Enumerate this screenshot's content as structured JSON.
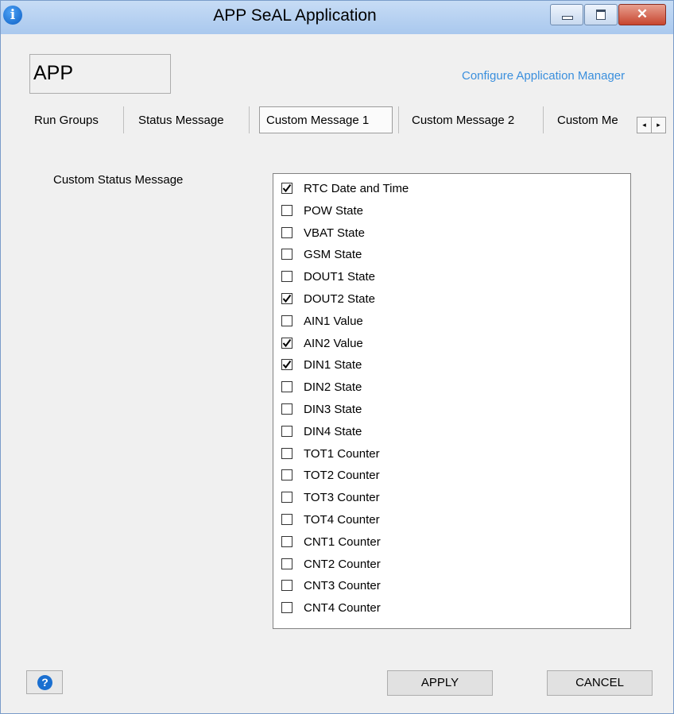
{
  "window": {
    "title": "APP SeAL Application",
    "icon": "info-icon",
    "icon_glyph": "i",
    "close_glyph": "✕",
    "accent_color": "#3a8fdd"
  },
  "header": {
    "app_name": "APP",
    "configure_link": "Configure Application Manager"
  },
  "tabs": [
    {
      "label": "Run Groups",
      "active": false
    },
    {
      "label": "Status Message",
      "active": false
    },
    {
      "label": "Custom Message 1",
      "active": true
    },
    {
      "label": "Custom Message 2",
      "active": false
    },
    {
      "label": "Custom Me",
      "active": false
    }
  ],
  "tab_scroll": {
    "left": "◂",
    "right": "▸"
  },
  "main": {
    "section_label": "Custom Status Message",
    "items": [
      {
        "label": "RTC Date and Time",
        "checked": true
      },
      {
        "label": "POW State",
        "checked": false
      },
      {
        "label": "VBAT State",
        "checked": false
      },
      {
        "label": "GSM State",
        "checked": false
      },
      {
        "label": "DOUT1 State",
        "checked": false
      },
      {
        "label": "DOUT2 State",
        "checked": true
      },
      {
        "label": "AIN1 Value",
        "checked": false
      },
      {
        "label": "AIN2 Value",
        "checked": true
      },
      {
        "label": "DIN1 State",
        "checked": true
      },
      {
        "label": "DIN2 State",
        "checked": false
      },
      {
        "label": "DIN3 State",
        "checked": false
      },
      {
        "label": "DIN4 State",
        "checked": false
      },
      {
        "label": "TOT1 Counter",
        "checked": false
      },
      {
        "label": "TOT2 Counter",
        "checked": false
      },
      {
        "label": "TOT3 Counter",
        "checked": false
      },
      {
        "label": "TOT4 Counter",
        "checked": false
      },
      {
        "label": "CNT1 Counter",
        "checked": false
      },
      {
        "label": "CNT2 Counter",
        "checked": false
      },
      {
        "label": "CNT3 Counter",
        "checked": false
      },
      {
        "label": "CNT4 Counter",
        "checked": false
      }
    ]
  },
  "footer": {
    "help_glyph": "?",
    "apply_label": "APPLY",
    "cancel_label": "CANCEL"
  }
}
